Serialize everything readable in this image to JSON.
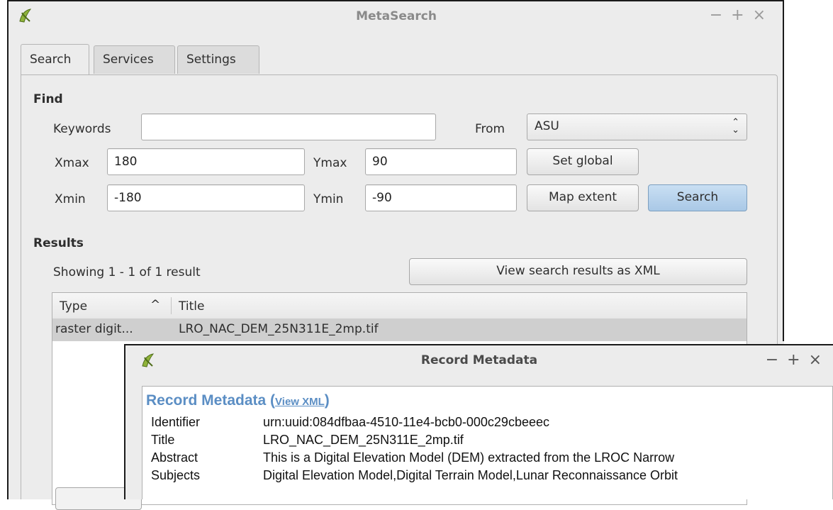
{
  "window": {
    "title": "MetaSearch",
    "controls": [
      "−",
      "+",
      "×"
    ]
  },
  "tabs": [
    {
      "label": "Search",
      "active": true
    },
    {
      "label": "Services",
      "active": false
    },
    {
      "label": "Settings",
      "active": false
    }
  ],
  "find": {
    "heading": "Find",
    "keywords_label": "Keywords",
    "keywords_value": "",
    "from_label": "From",
    "from_value": "ASU",
    "xmax_label": "Xmax",
    "xmax_value": "180",
    "ymax_label": "Ymax",
    "ymax_value": "90",
    "xmin_label": "Xmin",
    "xmin_value": "-180",
    "ymin_label": "Ymin",
    "ymin_value": "-90",
    "set_global_label": "Set global",
    "map_extent_label": "Map extent",
    "search_label": "Search"
  },
  "results": {
    "heading": "Results",
    "showing_text": "Showing 1 - 1 of 1 result",
    "view_xml_label": "View search results as XML",
    "columns": [
      "Type",
      "Title"
    ],
    "sort_indicator": "^",
    "rows": [
      {
        "type": "raster digit...",
        "title": "LRO_NAC_DEM_25N311E_2mp.tif"
      }
    ]
  },
  "dialog": {
    "title": "Record Metadata",
    "controls": [
      "−",
      "+",
      "×"
    ],
    "heading": "Record Metadata",
    "heading_open": " (",
    "view_xml_link": "View XML",
    "heading_close": ")",
    "fields": [
      {
        "key": "Identifier",
        "value": "urn:uuid:084dfbaa-4510-11e4-bcb0-000c29cbeeec"
      },
      {
        "key": "Title",
        "value": "LRO_NAC_DEM_25N311E_2mp.tif"
      },
      {
        "key": "Abstract",
        "value": "This is a Digital Elevation Model (DEM) extracted from the LROC Narrow"
      },
      {
        "key": "Subjects",
        "value": "Digital Elevation Model,Digital Terrain Model,Lunar Reconnaissance Orbit"
      }
    ]
  },
  "colors": {
    "link": "#5b8ec4",
    "selected_row": "#cfcfcf",
    "primary_button": "#b5d0ea"
  }
}
